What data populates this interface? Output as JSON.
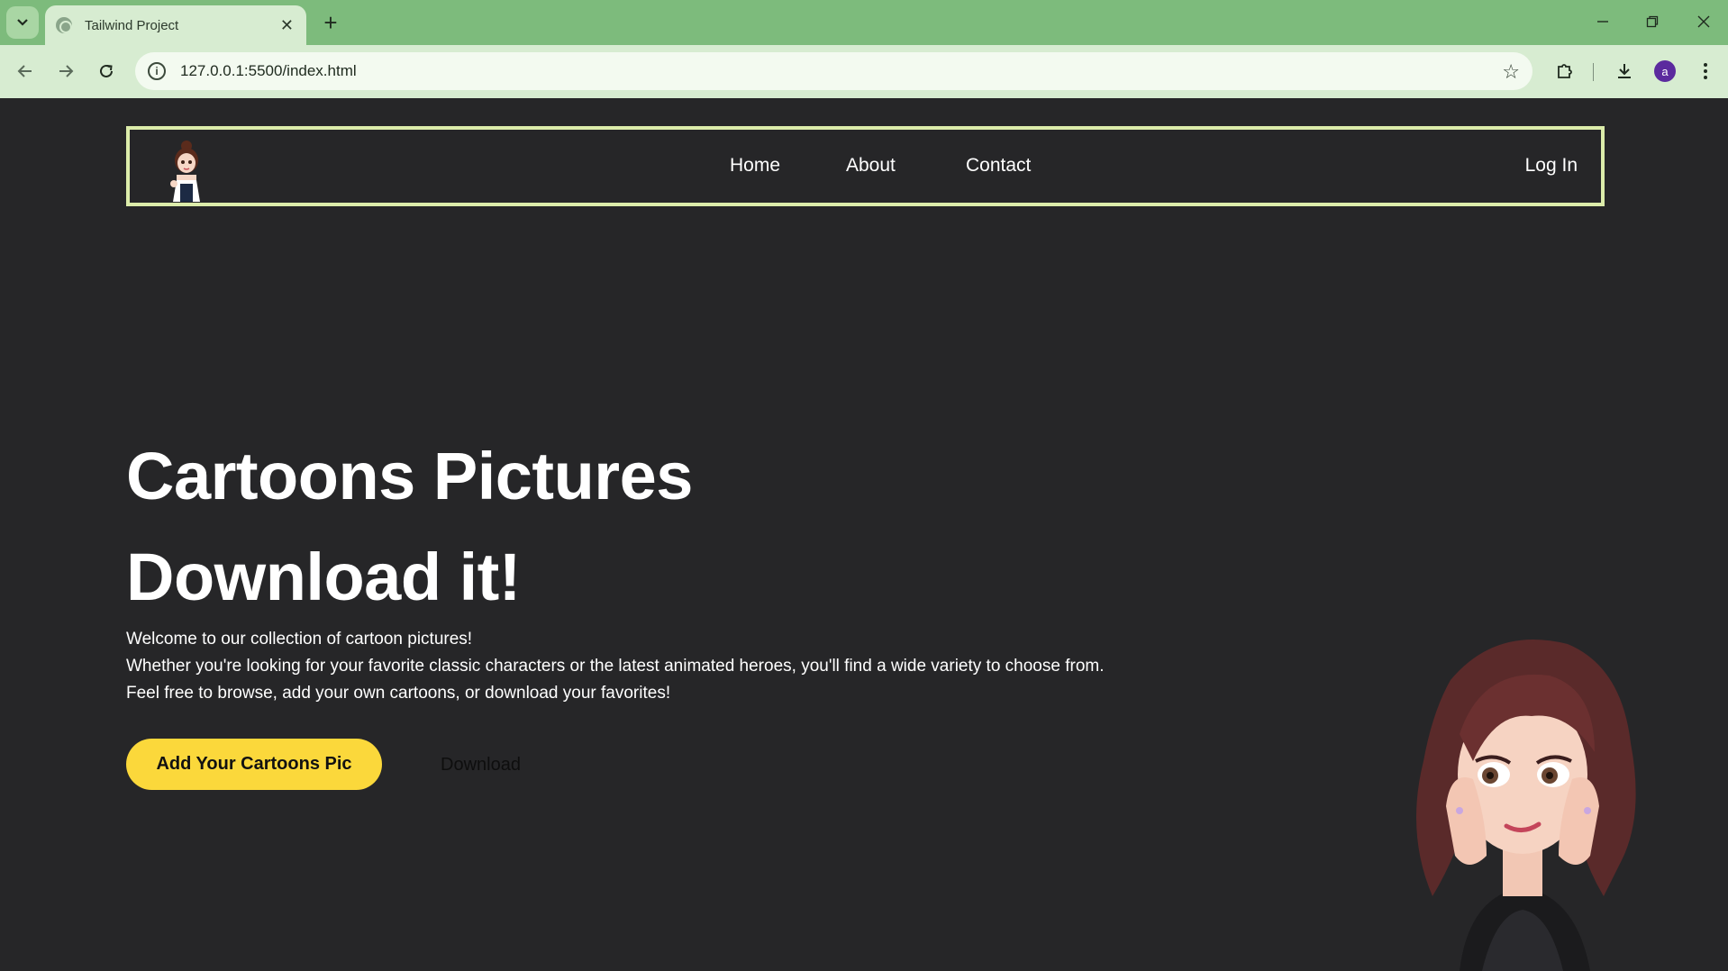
{
  "browser": {
    "tab_title": "Tailwind Project",
    "tab_close": "✕",
    "new_tab": "+",
    "url": "127.0.0.1:5500/index.html",
    "profile_initial": "a"
  },
  "nav": {
    "links": [
      "Home",
      "About",
      "Contact"
    ],
    "login": "Log In"
  },
  "hero": {
    "title_line1": "Cartoons Pictures",
    "title_line2": "Download it!",
    "paragraphs": [
      "Welcome to our collection of cartoon pictures!",
      "Whether you're looking for your favorite classic characters or the latest animated heroes, you'll find a wide variety to choose from.",
      "Feel free to browse, add your own cartoons, or download your favorites!"
    ],
    "cta_label": "Add Your Cartoons Pic",
    "download_label": "Download"
  },
  "colors": {
    "tabbar": "#7dbb7c",
    "toolbar": "#d7ecd1",
    "page_bg": "#262628",
    "nav_border": "#dcecaa",
    "cta_bg": "#fbd83b",
    "avatar": "#5b2a9e"
  }
}
